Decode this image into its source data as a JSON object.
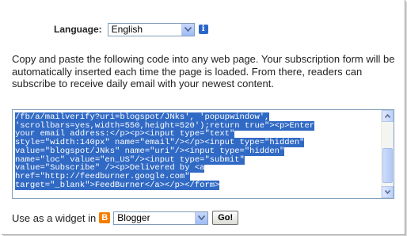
{
  "language": {
    "label": "Language:",
    "selected": "English"
  },
  "instructions": "Copy and paste the following code into any web page. Your subscription form will be automatically inserted each time the page is loaded. From there, readers can subscribe to receive daily email with your newest content.",
  "code_lines": [
    "/fb/a/mailverify?uri=blogspot/JNks', 'popupwindow',",
    "'scrollbars=yes,width=550,height=520');return true\"><p>Enter",
    "your email address:</p><p><input type=\"text\"",
    "style=\"width:140px\" name=\"email\"/></p><input type=\"hidden\"",
    "value=\"blogspot/JNks\" name=\"uri\"/><input type=\"hidden\"",
    "name=\"loc\" value=\"en_US\"/><input type=\"submit\"",
    "value=\"Subscribe\" /><p>Delivered by <a",
    "href=\"http://feedburner.google.com\"",
    "target=\"_blank\">FeedBurner</a></p></form>"
  ],
  "widget": {
    "label": "Use as a widget in",
    "platform_selected": "Blogger",
    "go_label": "Go!"
  },
  "icons": {
    "info": "info-icon",
    "blogger": "blogger-icon",
    "dropdown": "chevron-down-icon"
  },
  "colors": {
    "selection": "#316ac5",
    "border": "#7f9db9"
  }
}
